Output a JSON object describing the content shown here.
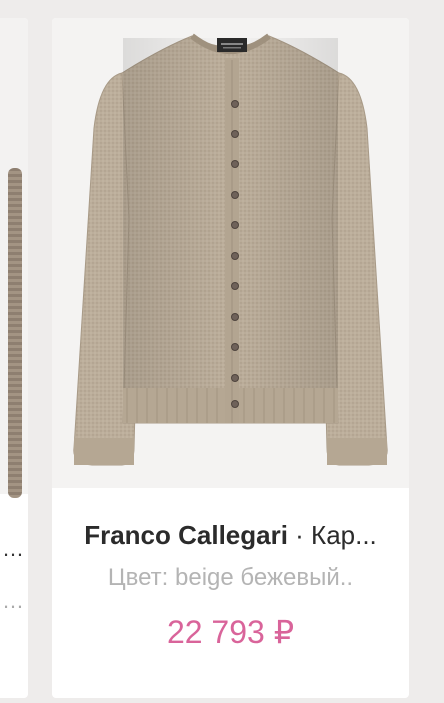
{
  "left_card": {
    "title_fragment": "…",
    "color_fragment": "…"
  },
  "product": {
    "brand": "Franco Callegari",
    "separator": " · ",
    "name_truncated": "Кар...",
    "color_label": "Цвет: beige бежевый..",
    "price": "22 793 ₽",
    "label_text": "Franco Callegari",
    "garment_color": "#bcae9b",
    "price_color": "#d9649a"
  }
}
